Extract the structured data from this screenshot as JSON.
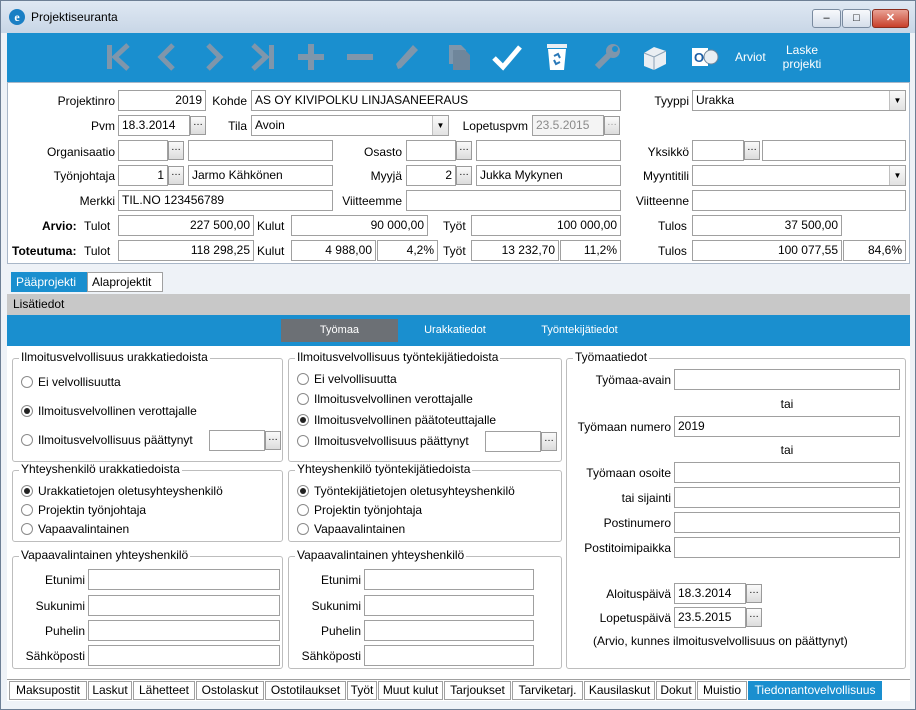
{
  "window": {
    "title": "Projektiseuranta",
    "min_label": "–",
    "max_label": "□",
    "close_label": "✕"
  },
  "toolbar": {
    "arviot": "Arviot",
    "laske_line1": "Laske",
    "laske_line2": "projekti",
    "accent": "#1a8fcf"
  },
  "form": {
    "projektinro_label": "Projektinro",
    "projektinro": "2019",
    "kohde_label": "Kohde",
    "kohde": "AS OY KIVIPOLKU LINJASANEERAUS",
    "tyyppi_label": "Tyyppi",
    "tyyppi": "Urakka",
    "pvm_label": "Pvm",
    "pvm": "18.3.2014",
    "tila_label": "Tila",
    "tila": "Avoin",
    "lopetuspvm_label": "Lopetuspvm",
    "lopetuspvm": "23.5.2015",
    "organisaatio_label": "Organisaatio",
    "osasto_label": "Osasto",
    "yksikko_label": "Yksikkö",
    "tyonjohtaja_label": "Työnjohtaja",
    "tyonjohtaja_nro": "1",
    "tyonjohtaja_nimi": "Jarmo Kähkönen",
    "myyja_label": "Myyjä",
    "myyja_nro": "2",
    "myyja_nimi": "Jukka Mykynen",
    "myyntitili_label": "Myyntitili",
    "merkki_label": "Merkki",
    "merkki": "TIL.NO 123456789",
    "viitteemme_label": "Viitteemme",
    "viitteenne_label": "Viitteenne",
    "arvio_label": "Arvio:",
    "tulot_label": "Tulot",
    "kulut_label": "Kulut",
    "tyot_label": "Työt",
    "tulos_label": "Tulos",
    "arvio_tulot": "227 500,00",
    "arvio_kulut": "90 000,00",
    "arvio_tyot": "100 000,00",
    "arvio_tulos": "37 500,00",
    "toteutuma_label": "Toteutuma:",
    "tot_tulot": "118 298,25",
    "tot_kulut": "4 988,00",
    "tot_kulut_pct": "4,2%",
    "tot_tyot": "13 232,70",
    "tot_tyot_pct": "11,2%",
    "tot_tulos": "100 077,55",
    "tot_tulos_pct": "84,6%"
  },
  "project_tabs": [
    "Pääprojekti",
    "Alaprojektit"
  ],
  "lisatiedot": "Lisätiedot",
  "sub_tabs": [
    "Työmaa",
    "Urakkatiedot",
    "Työntekijätiedot"
  ],
  "urakka_ilmoitus": {
    "title": "Ilmoitusvelvollisuus urakkatiedoista",
    "options": [
      "Ei velvollisuutta",
      "Ilmoitusvelvollinen verottajalle",
      "Ilmoitusvelvollisuus päättynyt"
    ],
    "selected": 1
  },
  "tyontekija_ilmoitus": {
    "title": "Ilmoitusvelvollisuus työntekijätiedoista",
    "options": [
      "Ei velvollisuutta",
      "Ilmoitusvelvollinen verottajalle",
      "Ilmoitusvelvollinen päätoteuttajalle",
      "Ilmoitusvelvollisuus päättynyt"
    ],
    "selected": 2
  },
  "urakka_yhteys": {
    "title": "Yhteyshenkilö urakkatiedoista",
    "options": [
      "Urakkatietojen oletusyhteyshenkilö",
      "Projektin työnjohtaja",
      "Vapaavalintainen"
    ],
    "selected": 0
  },
  "tyontekija_yhteys": {
    "title": "Yhteyshenkilö työntekijätiedoista",
    "options": [
      "Työntekijätietojen oletusyhteyshenkilö",
      "Projektin työnjohtaja",
      "Vapaavalintainen"
    ],
    "selected": 0
  },
  "vapaa_left": {
    "title": "Vapaavalintainen yhteyshenkilö",
    "fields": [
      "Etunimi",
      "Sukunimi",
      "Puhelin",
      "Sähköposti"
    ]
  },
  "vapaa_right": {
    "title": "Vapaavalintainen yhteyshenkilö",
    "fields": [
      "Etunimi",
      "Sukunimi",
      "Puhelin",
      "Sähköposti"
    ]
  },
  "tyomaatiedot": {
    "title": "Työmaatiedot",
    "avain_label": "Työmaa-avain",
    "tai": "tai",
    "numero_label": "Työmaan numero",
    "numero": "2019",
    "osoite_label": "Työmaan osoite",
    "sijainti_label": "tai sijainti",
    "postinumero_label": "Postinumero",
    "postitoimipaikka_label": "Postitoimipaikka",
    "aloitus_label": "Aloituspäivä",
    "aloitus": "18.3.2014",
    "lopetus_label": "Lopetuspäivä",
    "lopetus": "23.5.2015",
    "note": "(Arvio, kunnes ilmoitusvelvollisuus on päättynyt)"
  },
  "bottom_tabs": [
    "Maksupostit",
    "Laskut",
    "Lähetteet",
    "Ostolaskut",
    "Ostotilaukset",
    "Työt",
    "Muut kulut",
    "Tarjoukset",
    "Tarviketarj.",
    "Kausilaskut",
    "Dokut",
    "Muistio",
    "Tiedonantovelvollisuus"
  ],
  "active_bottom_tab": "Tiedonantovelvollisuus"
}
